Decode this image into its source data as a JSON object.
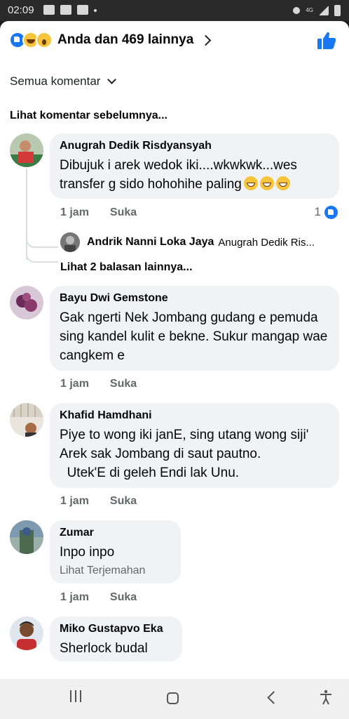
{
  "status_bar": {
    "time": "02:09",
    "network": "4G"
  },
  "header": {
    "reactions_text": "Anda dan 469 lainnya",
    "reaction_icons": [
      "like-icon",
      "haha-icon",
      "wow-icon"
    ]
  },
  "sort": {
    "label": "Semua komentar"
  },
  "previous_comments_link": "Lihat komentar sebelumnya...",
  "comments": [
    {
      "author": "Anugrah Dedik Risdyansyah",
      "text": "Dibujuk i arek wedok iki....wkwkwk...wes transfer g sido hohohihe paling",
      "emoji_count": 3,
      "time": "1 jam",
      "like_label": "Suka",
      "like_count": "1",
      "reply": {
        "author": "Andrik Nanni Loka Jaya",
        "text": "Anugrah Dedik Ris..."
      },
      "more_replies": "Lihat 2 balasan lainnya..."
    },
    {
      "author": "Bayu Dwi Gemstone",
      "text": "Gak ngerti Nek Jombang gudang e pemuda sing kandel kulit e bekne. Sukur mangap wae cangkem e",
      "time": "1 jam",
      "like_label": "Suka"
    },
    {
      "author": "Khafid Hamdhani",
      "text": "Piye to wong iki janE, sing utang wong siji' Arek sak Jombang di saut pautno.\n  Utek'E di geleh Endi lak Unu.",
      "time": "1 jam",
      "like_label": "Suka"
    },
    {
      "author": "Zumar",
      "text": "Inpo inpo",
      "translate": "Lihat Terjemahan",
      "time": "1 jam",
      "like_label": "Suka"
    },
    {
      "author": "Miko Gustapvo Eka",
      "text": "Sherlock budal"
    }
  ],
  "colors": {
    "accent": "#1877f2",
    "bubble": "#f0f2f5",
    "meta_text": "#65676b"
  }
}
